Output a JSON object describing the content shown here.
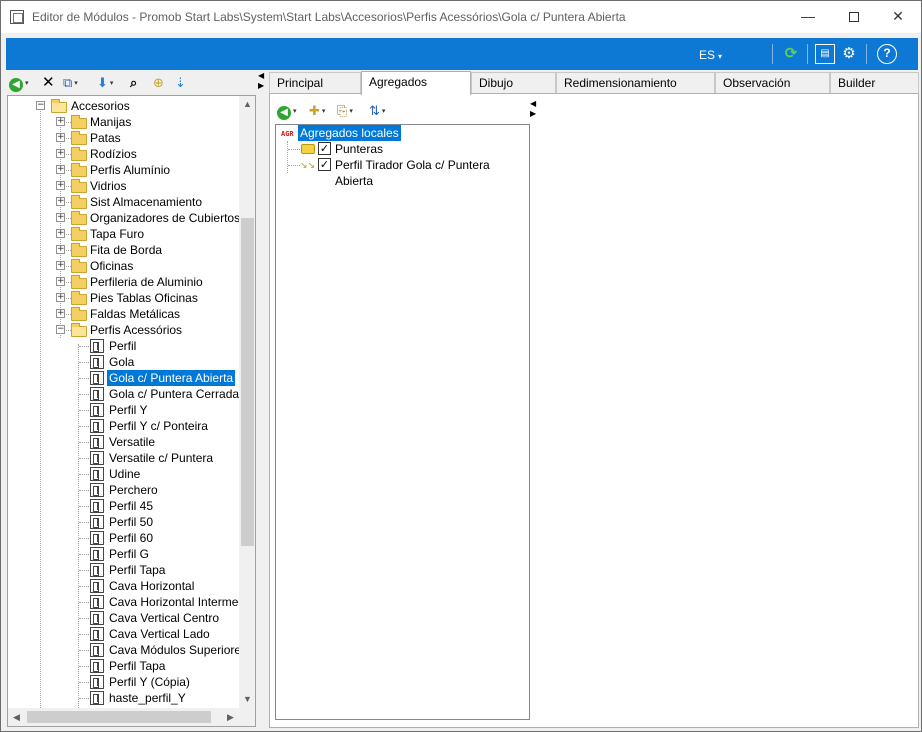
{
  "window": {
    "title": "Editor de Módulos - Promob Start Labs\\System\\Start Labs\\Accesorios\\Perfis Acessórios\\Gola c/ Puntera Abierta",
    "minimize_glyph": "—",
    "close_glyph": "✕"
  },
  "bluebar": {
    "language": "ES",
    "language_caret": "▾",
    "sync_glyph": "⟳",
    "panel_glyph": "▤",
    "settings_glyph": "⚙",
    "help_glyph": "?"
  },
  "left_toolbar": {
    "back_glyph": "◀",
    "delete_glyph": "✕",
    "copy_glyph": "⧉",
    "down_glyph": "⬇",
    "find_glyph": "⌕",
    "folder_glyph": "⊕",
    "link_glyph": "⇣",
    "dropdown_glyph": "▾"
  },
  "tree": {
    "root": {
      "label": "Accesorios",
      "expander": "−"
    },
    "folders": [
      {
        "label": "Manijas",
        "expander": "+"
      },
      {
        "label": "Patas",
        "expander": "+"
      },
      {
        "label": "Rodízios",
        "expander": "+"
      },
      {
        "label": "Perfis Alumínio",
        "expander": "+"
      },
      {
        "label": "Vidrios",
        "expander": "+"
      },
      {
        "label": "Sist Almacenamiento",
        "expander": "+"
      },
      {
        "label": "Organizadores de Cubiertos",
        "expander": "+"
      },
      {
        "label": "Tapa Furo",
        "expander": "+"
      },
      {
        "label": "Fita de Borda",
        "expander": "+"
      },
      {
        "label": "Oficinas",
        "expander": "+"
      },
      {
        "label": "Perfileria de Aluminio",
        "expander": "+"
      },
      {
        "label": "Pies Tablas Oficinas",
        "expander": "+"
      },
      {
        "label": "Faldas Metálicas",
        "expander": "+"
      },
      {
        "label": "Perfis Acessórios",
        "expander": "−"
      }
    ],
    "modules": [
      "Perfil",
      "Gola",
      "Gola c/ Puntera Abierta",
      "Gola c/ Puntera Cerrada",
      "Perfil Y",
      "Perfil Y c/ Ponteira",
      "Versatile",
      "Versatile c/ Puntera",
      "Udine",
      "Perchero",
      "Perfil 45",
      "Perfil 50",
      "Perfil 60",
      "Perfil G",
      "Perfil Tapa",
      "Cava Horizontal",
      "Cava Horizontal Intermedi",
      "Cava Vertical Centro",
      "Cava Vertical Lado",
      "Cava Módulos Superiores",
      "Perfil Tapa",
      "Perfil Y (Cópia)",
      "haste_perfil_Y"
    ],
    "selected_module_index": 2,
    "scroll_up": "▲",
    "scroll_down": "▼",
    "scroll_left": "◀",
    "scroll_right": "▶"
  },
  "splitter": {
    "left": "◀",
    "right": "▶"
  },
  "tabs": [
    {
      "label": "Principal",
      "active": false
    },
    {
      "label": "Agregados",
      "active": true
    },
    {
      "label": "Dibujo",
      "active": false
    },
    {
      "label": "Redimensionamiento",
      "active": false
    },
    {
      "label": "Observación",
      "active": false
    },
    {
      "label": "Builder",
      "active": false
    }
  ],
  "right_toolbar": {
    "back_glyph": "◀",
    "new_glyph": "✚",
    "paste_glyph": "⎘",
    "sort_glyph": "⇅",
    "dropdown_glyph": "▾"
  },
  "aggregates": {
    "root_icon": "AGR",
    "root_label": "Agregados locales",
    "items": [
      {
        "label": "Punteras",
        "checked": true,
        "check_glyph": "✓"
      },
      {
        "label": "Perfil Tirador Gola c/ Puntera Abierta",
        "checked": true,
        "check_glyph": "✓",
        "arrow_glyph": "↘↘"
      }
    ]
  },
  "colors": {
    "accent": "#0d79d4",
    "selection": "#0078d7",
    "folder": "#f3d061"
  }
}
